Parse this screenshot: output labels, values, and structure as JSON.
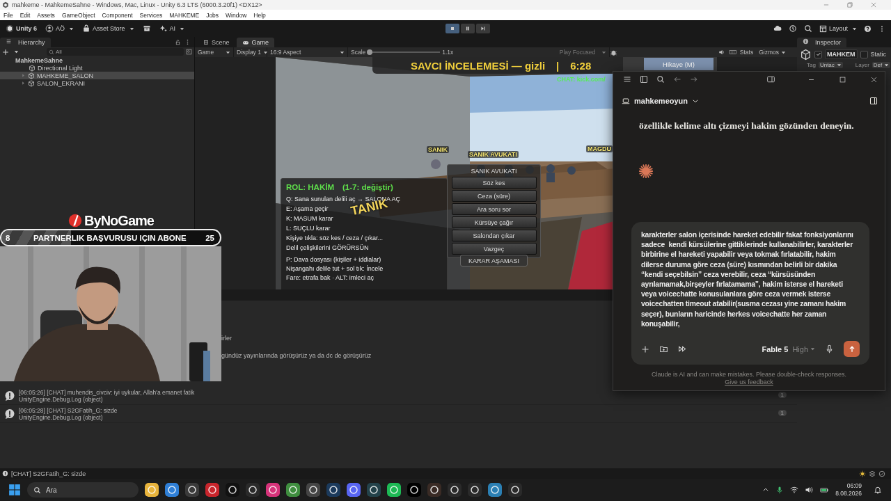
{
  "window": {
    "title": "mahkeme - MahkemeSahne - Windows, Mac, Linux - Unity 6.3 LTS (6000.3.20f1) <DX12>"
  },
  "menu": [
    "File",
    "Edit",
    "Assets",
    "GameObject",
    "Component",
    "Services",
    "MAHKEME",
    "Jobs",
    "Window",
    "Help"
  ],
  "toolbar": {
    "product": "Unity 6",
    "account": "AÖ",
    "asset_store": "Asset Store",
    "ai": "AI",
    "layout": "Layout",
    "play_controls": [
      {
        "kind": "stop",
        "on": true
      },
      {
        "kind": "pause",
        "on": false
      },
      {
        "kind": "step",
        "on": false
      }
    ]
  },
  "hierarchy": {
    "title": "Hierarchy",
    "search": {
      "placeholder": "All"
    },
    "scene": "MahkemeSahne",
    "children": [
      {
        "name": "Directional Light",
        "expandable": false,
        "selected": false
      },
      {
        "name": "MAHKEME_SALON",
        "expandable": true,
        "selected": true
      },
      {
        "name": "SALON_EKRANI",
        "expandable": true,
        "selected": false
      }
    ]
  },
  "view_tabs": [
    {
      "label": "Scene",
      "selected": false
    },
    {
      "label": "Game",
      "selected": true
    }
  ],
  "game_toolbar": {
    "mode": "Game",
    "display": "Display 1",
    "aspect": "16:9 Aspect",
    "scale_label": "Scale",
    "scale": {
      "level": 0.03
    },
    "scale_value": "1.1x",
    "play_focused": "Play Focused",
    "stats": "Stats",
    "gizmos": "Gizmos"
  },
  "game": {
    "hud_title": "SAVCI İNCELEMESİ — gizli",
    "hud_separator": "|",
    "timer": "6:28",
    "chat": "CHAT: kick.com/",
    "story_button": "Hikaye (M)",
    "world_labels": [
      {
        "text": "SANIK",
        "kind": "plain"
      },
      {
        "text": "SANIK AVUKATI",
        "kind": "plain"
      },
      {
        "text": "MAGDU",
        "kind": "plain"
      },
      {
        "text": "TANIK",
        "kind": "tilted"
      }
    ],
    "role_panel": {
      "title": "ROL: HAKİM",
      "hint": "(1-7: değiştir)",
      "lines": [
        "Q: Sana sunulan delili aç → SALONA AÇ",
        "E: Aşama geçir",
        "K: MASUM karar",
        "L: SUÇLU karar",
        "Kişiye tıkla: söz kes / ceza / çıkar...",
        "Delil çelişkilerini GÖRÜRSÜN"
      ],
      "help_lines": [
        "P: Dava dosyası (kişiler + iddialar)",
        "Nişangahı delile tut + sol tık: İncele",
        "Fare: etrafa bak  ·  ALT: imleci aç"
      ]
    },
    "action_menu": {
      "title": "SANIK AVUKATI",
      "buttons": [
        "Söz kes",
        "Ceza (süre)",
        "Ara soru sor",
        "Kürsüye çağır",
        "Salondan çıkar",
        "Vazgeç"
      ],
      "verdict_button": "KARAR AŞAMASI"
    }
  },
  "inspector": {
    "title": "Inspector",
    "active": {
      "checked": true
    },
    "name": "MAHKEM",
    "static": {
      "label": "Static",
      "checked": false
    },
    "tag_label": "Tag",
    "tag": "Untac",
    "layer_label": "Layer",
    "layer": "Def"
  },
  "console": {
    "partial_lines": [
      "irler",
      "gündüz yayınlarında görüşürüz ya da dc de görüşürüz"
    ],
    "entries": [
      {
        "message": "[06:05:26] [CHAT] muhendis_civciv: iyi uykular, Allah'a emanet fatik",
        "source": "UnityEngine.Debug.Log (object)",
        "count": "1"
      },
      {
        "message": "[06:05:28] [CHAT] S2GFatih_G: sizde",
        "source": "UnityEngine.Debug.Log (object)",
        "count": "1"
      }
    ]
  },
  "status_bar": "[CHAT] S2GFatih_G: sizde",
  "stream_overlay": {
    "logo": "ByNoGame",
    "goal": {
      "current": "8",
      "label": "PARTNERLIK BAŞVURUSU IÇIN ABONE",
      "target": "25",
      "level": 0.32
    }
  },
  "claude": {
    "project": "mahkemeoyun",
    "message": "özellikle kelime altı çizmeyi hakim gözünden deneyin.",
    "input": {
      "value": "karakterler salon içerisinde hareket edebilir fakat fonksiyonlarını sadece  kendi kürsülerine gittiklerinde kullanabilirler, karakterler birbirine el hareketi yapabilir veya tokmak fırlatabilir, hakim dilerse duruma göre ceza (süre) kısmından belirli bir dakika “kendi seçebilsin” ceza verebilir, ceza “kürsüsünden ayrılamamak,birşeyler fırlatamama”, hakim isterse el hareketi veya voicechatte konusulanlara göre ceza vermek isterse voicechatten timeout atabilir(susma cezası yine zamanı hakim seçer), bunların haricinde herkes voicechatte her zaman konuşabilir,"
    },
    "model": "Fable 5",
    "effort": "High",
    "disclaimer": "Claude is AI and can make mistakes. Please double-check responses.",
    "feedback_link": "Give us feedback"
  },
  "taskbar": {
    "search": {
      "placeholder": "Ara"
    },
    "time": "06:09",
    "date": "8.08.2026"
  }
}
